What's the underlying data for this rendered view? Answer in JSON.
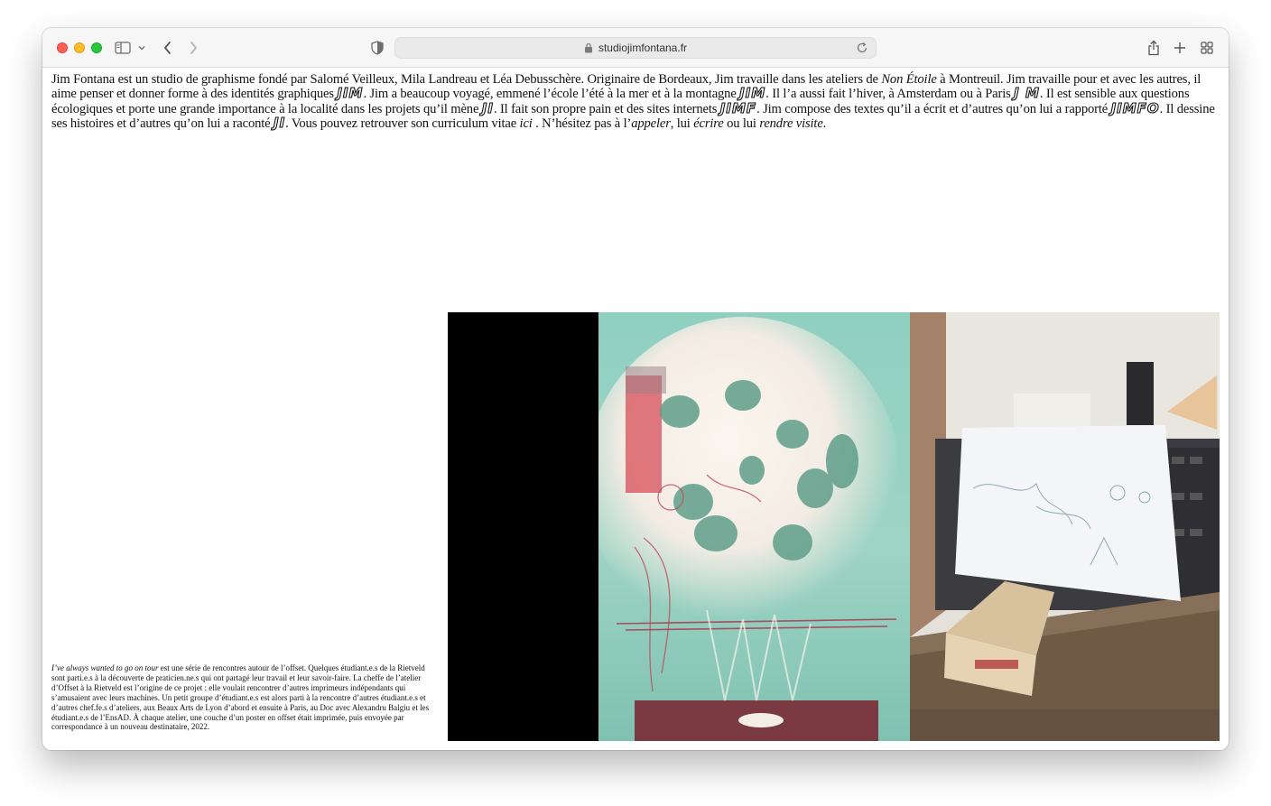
{
  "browser": {
    "url": "studiojimfontana.fr"
  },
  "intro": {
    "p1": "Jim Fontana est un studio de graphisme fondé par Salomé Veilleux, Mila Landreau et Léa Debusschère. Originaire de Bordeaux, Jim travaille dans les ateliers de ",
    "non_etoile": "Non Étoile",
    "p2": " à Montreuil. Jim travaille pour et avec les autres, il aime penser et donner forme à des identités graphiques ",
    "logo1": "JIM",
    "p3": ". Jim a beaucoup voyagé, emmené l’école l’été à la mer et à la montagne ",
    "logo2": "JIM",
    "p4": ". Il l’a aussi fait l’hiver, à Amsterdam ou à Paris ",
    "logo3": "J M",
    "p5": ". Il est sensible aux questions écologiques et porte une grande importance à la localité dans les projets qu’il mène ",
    "logo4": "JI",
    "p6": ". Il fait son propre pain et des sites internets ",
    "logo5": "JIMF",
    "p7": ". Jim compose des textes qu’il a écrit et d’autres qu’on lui a rapporté ",
    "logo6": "JIMFO",
    "p8": ". Il dessine ses histoires et d’autres qu’on lui a raconté ",
    "logo7": "JI",
    "p9": ". Vous pouvez retrouver son curriculum vitae ",
    "link_ici": "ici",
    "p10": " . N’hésitez pas à l’",
    "link_appeler": "appeler",
    "p11": ", lui ",
    "link_ecrire": "écrire",
    "p12": " ou lui ",
    "link_visite": "rendre visite",
    "p13": "."
  },
  "caption": {
    "title": "I’ve always wanted to go on tour",
    "body": " est une série de rencontres autour de l’offset. Quelques étudiant.e.s de la Rietveld sont parti.e.s à la découverte de praticien.ne.s qui ont partagé leur travail et leur savoir-faire. La cheffe de l’atelier d’Offset à la Rietveld est l’origine de ce projet : elle voulait rencontrer d’autres imprimeurs indépendants qui s’amusaient avec leurs machines. Un petit groupe d’étudiant.e.s est alors parti à la rencontre d’autres étudiant.e.s et d’autres chef.fe.s d’ateliers, aux Beaux Arts de Lyon d’abord et ensuite à Paris, au Doc avec Alexandru Balgiu et les étudiant.e.s de l’EnsAD. À chaque atelier, une couche d’un poster en offset était imprimée, puis envoyée par correspondance à un nouveau destinataire, 2022."
  },
  "colors": {
    "close": "#ff5f57",
    "minimize": "#febc2e",
    "zoom": "#28c840"
  }
}
